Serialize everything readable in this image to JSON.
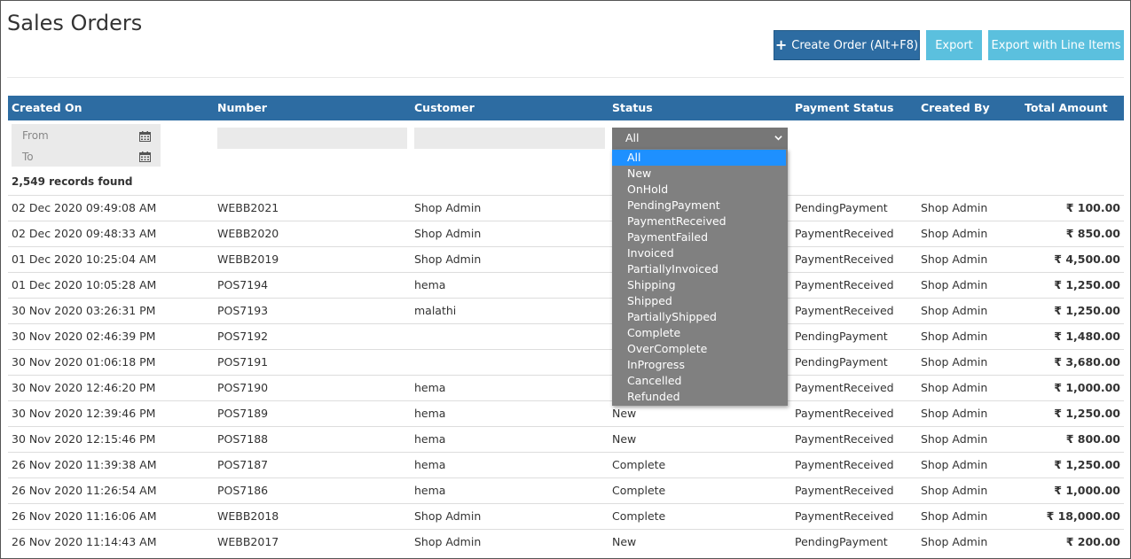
{
  "page": {
    "title": "Sales Orders"
  },
  "toolbar": {
    "create_label": "Create Order (Alt+F8)",
    "export_label": "Export",
    "export_line_items_label": "Export with Line Items"
  },
  "table": {
    "columns": [
      "Created On",
      "Number",
      "Customer",
      "Status",
      "Payment Status",
      "Created By",
      "Total Amount"
    ],
    "filters": {
      "from_label": "From",
      "to_label": "To",
      "status_selected": "All"
    },
    "records_found": "2,549 records found",
    "rows": [
      {
        "created_on": "02 Dec 2020 09:49:08 AM",
        "number": "WEBB2021",
        "customer": "Shop Admin",
        "status": "",
        "payment_status": "PendingPayment",
        "created_by": "Shop Admin",
        "total": "₹ 100.00"
      },
      {
        "created_on": "02 Dec 2020 09:48:33 AM",
        "number": "WEBB2020",
        "customer": "Shop Admin",
        "status": "",
        "payment_status": "PaymentReceived",
        "created_by": "Shop Admin",
        "total": "₹ 850.00"
      },
      {
        "created_on": "01 Dec 2020 10:25:04 AM",
        "number": "WEBB2019",
        "customer": "Shop Admin",
        "status": "",
        "payment_status": "PaymentReceived",
        "created_by": "Shop Admin",
        "total": "₹ 4,500.00"
      },
      {
        "created_on": "01 Dec 2020 10:05:28 AM",
        "number": "POS7194",
        "customer": "hema",
        "status": "",
        "payment_status": "PaymentReceived",
        "created_by": "Shop Admin",
        "total": "₹ 1,250.00"
      },
      {
        "created_on": "30 Nov 2020 03:26:31 PM",
        "number": "POS7193",
        "customer": "malathi",
        "status": "",
        "payment_status": "PaymentReceived",
        "created_by": "Shop Admin",
        "total": "₹ 1,250.00"
      },
      {
        "created_on": "30 Nov 2020 02:46:39 PM",
        "number": "POS7192",
        "customer": "",
        "status": "",
        "payment_status": "PendingPayment",
        "created_by": "Shop Admin",
        "total": "₹ 1,480.00"
      },
      {
        "created_on": "30 Nov 2020 01:06:18 PM",
        "number": "POS7191",
        "customer": "",
        "status": "",
        "payment_status": "PendingPayment",
        "created_by": "Shop Admin",
        "total": "₹ 3,680.00"
      },
      {
        "created_on": "30 Nov 2020 12:46:20 PM",
        "number": "POS7190",
        "customer": "hema",
        "status": "",
        "payment_status": "PaymentReceived",
        "created_by": "Shop Admin",
        "total": "₹ 1,000.00"
      },
      {
        "created_on": "30 Nov 2020 12:39:46 PM",
        "number": "POS7189",
        "customer": "hema",
        "status": "New",
        "payment_status": "PaymentReceived",
        "created_by": "Shop Admin",
        "total": "₹ 1,250.00"
      },
      {
        "created_on": "30 Nov 2020 12:15:46 PM",
        "number": "POS7188",
        "customer": "hema",
        "status": "New",
        "payment_status": "PaymentReceived",
        "created_by": "Shop Admin",
        "total": "₹ 800.00"
      },
      {
        "created_on": "26 Nov 2020 11:39:38 AM",
        "number": "POS7187",
        "customer": "hema",
        "status": "Complete",
        "payment_status": "PaymentReceived",
        "created_by": "Shop Admin",
        "total": "₹ 1,250.00"
      },
      {
        "created_on": "26 Nov 2020 11:26:54 AM",
        "number": "POS7186",
        "customer": "hema",
        "status": "Complete",
        "payment_status": "PaymentReceived",
        "created_by": "Shop Admin",
        "total": "₹ 1,000.00"
      },
      {
        "created_on": "26 Nov 2020 11:16:06 AM",
        "number": "WEBB2018",
        "customer": "Shop Admin",
        "status": "Complete",
        "payment_status": "PaymentReceived",
        "created_by": "Shop Admin",
        "total": "₹ 18,000.00"
      },
      {
        "created_on": "26 Nov 2020 11:14:43 AM",
        "number": "WEBB2017",
        "customer": "Shop Admin",
        "status": "New",
        "payment_status": "PendingPayment",
        "created_by": "Shop Admin",
        "total": "₹ 200.00"
      }
    ]
  },
  "status_dropdown": {
    "options": [
      "All",
      "New",
      "OnHold",
      "PendingPayment",
      "PaymentReceived",
      "PaymentFailed",
      "Invoiced",
      "PartiallyInvoiced",
      "Shipping",
      "Shipped",
      "PartiallyShipped",
      "Complete",
      "OverComplete",
      "InProgress",
      "Cancelled",
      "Refunded"
    ],
    "highlighted": "All"
  },
  "colors": {
    "header_bg": "#2d6ca2",
    "primary_button": "#2d6ca2",
    "info_button": "#5bc0de",
    "dropdown_bg": "#808080",
    "dropdown_highlight": "#1e90ff"
  },
  "icons": {
    "create": "plus-icon",
    "date": "calendar-icon",
    "select": "chevron-down-icon"
  }
}
